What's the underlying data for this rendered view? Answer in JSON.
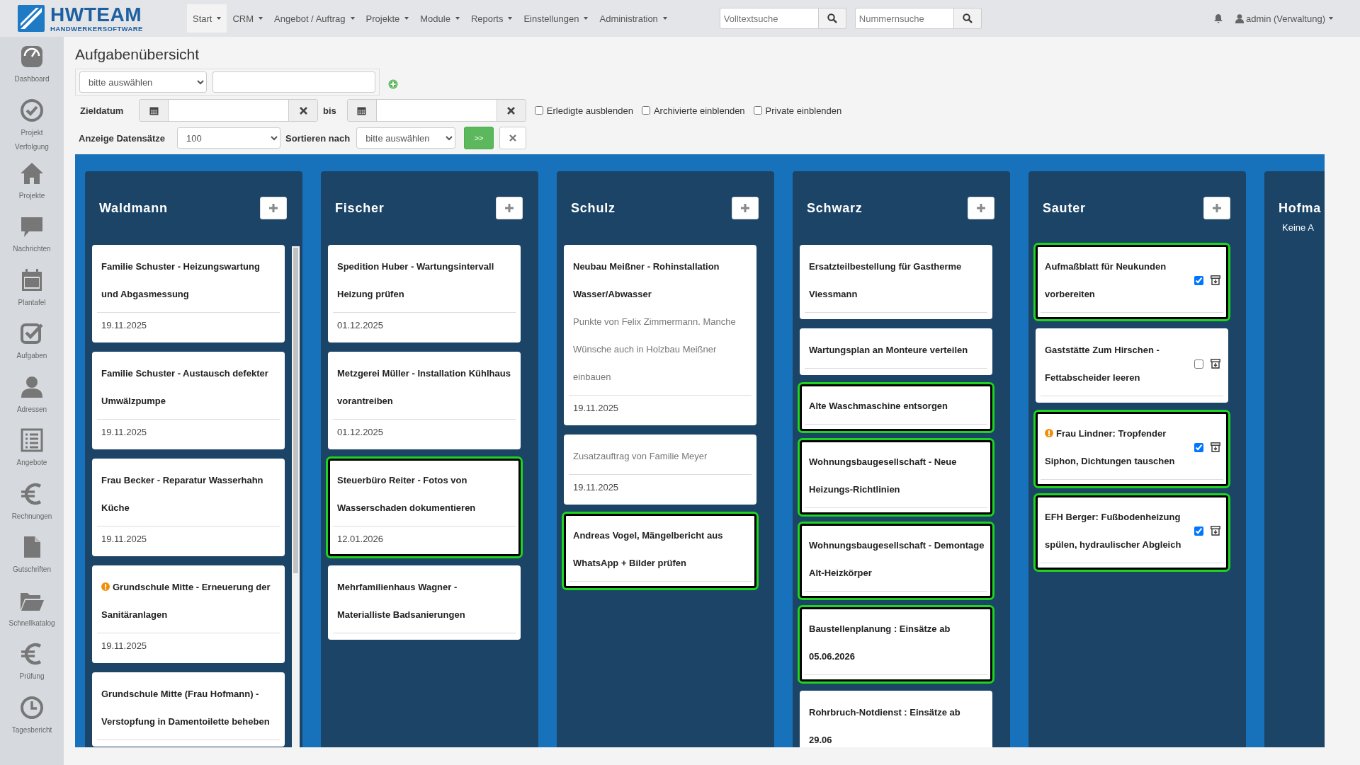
{
  "logo": {
    "title": "HWTEAM",
    "subtitle": "HANDWERKERSOFTWARE"
  },
  "menu": [
    {
      "label": "Start",
      "selected": true
    },
    {
      "label": "CRM",
      "selected": false
    },
    {
      "label": "Angebot / Auftrag",
      "selected": false
    },
    {
      "label": "Projekte",
      "selected": false
    },
    {
      "label": "Module",
      "selected": false
    },
    {
      "label": "Reports",
      "selected": false
    },
    {
      "label": "Einstellungen",
      "selected": false
    },
    {
      "label": "Administration",
      "selected": false
    }
  ],
  "search": [
    {
      "placeholder": "Volltextsuche"
    },
    {
      "placeholder": "Nummernsuche"
    }
  ],
  "user": "admin (Verwaltung)",
  "sidebar": [
    {
      "label": "Dashboard"
    },
    {
      "label": "Projekt Verfolgung"
    },
    {
      "label": "Projekte"
    },
    {
      "label": "Nachrichten"
    },
    {
      "label": "Plantafel"
    },
    {
      "label": "Aufgaben"
    },
    {
      "label": "Adressen"
    },
    {
      "label": "Angebote"
    },
    {
      "label": "Rechnungen"
    },
    {
      "label": "Gutschriften"
    },
    {
      "label": "Schnellkatalog"
    },
    {
      "label": "Prüfung"
    },
    {
      "label": "Tagesbericht"
    }
  ],
  "page_title": "Aufgabenübersicht",
  "filter": {
    "field_select": "bitte auswählen",
    "date_label": "Zieldatum",
    "bis_label": "bis",
    "checkboxes": [
      {
        "label": "Erledigte ausblenden",
        "checked": false
      },
      {
        "label": "Archivierte einblenden",
        "checked": false
      },
      {
        "label": "Private einblenden",
        "checked": false
      }
    ],
    "count_label": "Anzeige Datensätze",
    "count_value": "100",
    "sort_label": "Sortieren nach",
    "sort_value": "bitte auswählen",
    "apply_button": ">>"
  },
  "columns": [
    {
      "name": "Waldmann",
      "cards": [
        {
          "kind": "task",
          "title": "Familie Schuster - Heizungswartung und Abgasmessung",
          "date": "19.11.2025",
          "highlighted": false,
          "warning": false
        },
        {
          "kind": "task",
          "title": "Familie Schuster - Austausch defekter Umwälzpumpe",
          "date": "19.11.2025",
          "highlighted": false,
          "warning": false
        },
        {
          "kind": "task",
          "title": "Frau Becker - Reparatur Wasserhahn Küche",
          "date": "19.11.2025",
          "highlighted": false,
          "warning": false
        },
        {
          "kind": "task",
          "title": "Grundschule Mitte - Erneuerung der Sanitäranlagen",
          "date": "19.11.2025",
          "highlighted": false,
          "warning": true
        },
        {
          "kind": "task",
          "title": "Grundschule Mitte (Frau Hofmann) - Verstopfung in Damentoilette beheben",
          "highlighted": false,
          "warning": false
        }
      ]
    },
    {
      "name": "Fischer",
      "cards": [
        {
          "kind": "task",
          "title": "Spedition Huber - Wartungsintervall Heizung prüfen",
          "date": "01.12.2025",
          "highlighted": false,
          "warning": false
        },
        {
          "kind": "task",
          "title": "Metzgerei Müller - Installation Kühlhaus vorantreiben",
          "date": "01.12.2025",
          "highlighted": false,
          "warning": false
        },
        {
          "kind": "task",
          "title": "Steuerbüro Reiter - Fotos von Wasserschaden dokumentieren",
          "date": "12.01.2026",
          "highlighted": true,
          "warning": false
        },
        {
          "kind": "task",
          "title": "Mehrfamilienhaus Wagner - Materialliste Badsanierungen",
          "highlighted": false,
          "warning": false
        }
      ]
    },
    {
      "name": "Schulz",
      "cards": [
        {
          "kind": "task",
          "title": "Neubau Meißner - Rohinstallation Wasser/Abwasser",
          "description": "Punkte von Felix Zimmermann. Manche Wünsche auch in Holzbau Meißner einbauen",
          "date": "19.11.2025",
          "highlighted": false,
          "warning": false
        },
        {
          "kind": "task",
          "description": "Zusatzauftrag von Familie Meyer",
          "date": "19.11.2025",
          "highlighted": false
        },
        {
          "kind": "task",
          "title": "Andreas Vogel, Mängelbericht aus WhatsApp + Bilder prüfen",
          "highlighted": true,
          "warning": false
        }
      ]
    },
    {
      "name": "Schwarz",
      "cards": [
        {
          "kind": "task",
          "title": "Ersatzteilbestellung für Gastherme Viessmann",
          "highlighted": false,
          "warning": false
        },
        {
          "kind": "task",
          "title": "Wartungsplan an Monteure verteilen",
          "highlighted": false,
          "warning": false
        },
        {
          "kind": "task",
          "title": "Alte Waschmaschine entsorgen",
          "highlighted": true,
          "warning": false
        },
        {
          "kind": "task",
          "title": "Wohnungsbaugesellschaft - Neue Heizungs-Richtlinien",
          "highlighted": true,
          "warning": false
        },
        {
          "kind": "task",
          "title": "Wohnungsbaugesellschaft - Demontage Alt-Heizkörper",
          "highlighted": true,
          "warning": false
        },
        {
          "kind": "task",
          "title": "Baustellenplanung : Einsätze ab 05.06.2026",
          "highlighted": true,
          "warning": false
        },
        {
          "kind": "task",
          "title": "Rohrbruch-Notdienst : Einsätze ab 29.06",
          "highlighted": false,
          "warning": false
        }
      ]
    },
    {
      "name": "Sauter",
      "cards": [
        {
          "kind": "check",
          "title": "Aufmaßblatt für Neukunden vorbereiten",
          "highlighted": true,
          "warning": false,
          "checked": true
        },
        {
          "kind": "check",
          "title": "Gaststätte Zum Hirschen - Fettabscheider leeren",
          "highlighted": false,
          "warning": false,
          "checked": false
        },
        {
          "kind": "check",
          "title": "Frau Lindner: Tropfender Siphon, Dichtungen tauschen",
          "highlighted": true,
          "warning": true,
          "checked": true
        },
        {
          "kind": "check",
          "title": "EFH Berger: Fußbodenheizung spülen, hydraulischer Abgleich",
          "highlighted": true,
          "warning": false,
          "checked": true
        }
      ]
    },
    {
      "name": "Hofma",
      "empty_text": "Keine A"
    }
  ]
}
